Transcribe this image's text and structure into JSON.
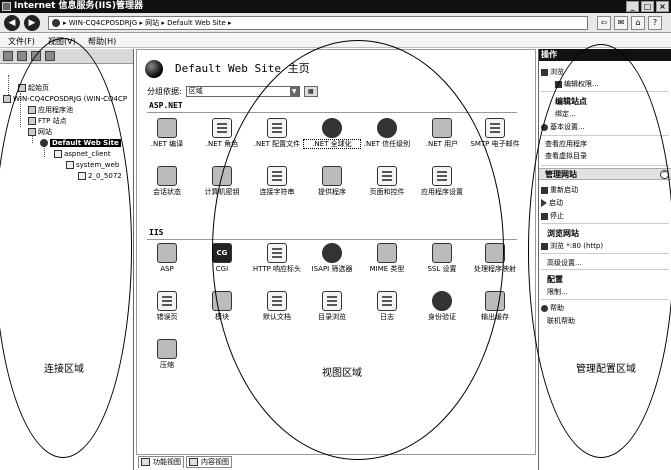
{
  "window": {
    "title": "Internet 信息服务(IIS)管理器",
    "controls": [
      "_",
      "□",
      "×"
    ]
  },
  "navbar": {
    "back": "◀",
    "forward": "▶",
    "address": "▸ WIN-CQ4CPOSDRJG ▸ 网站 ▸ Default Web Site ▸",
    "tools": [
      "⇦",
      "✉",
      "⌂",
      "?"
    ]
  },
  "menu": [
    "文件(F)",
    "视图(V)",
    "帮助(H)"
  ],
  "tree": [
    "起始页",
    "WIN-CQ4CPOSDRJG (WIN-CQ4CP",
    "应用程序池",
    "FTP 站点",
    "网站",
    "Default Web Site",
    "aspnet_client",
    "system_web",
    "2_0_5072"
  ],
  "center": {
    "title": "Default Web Site 主页",
    "group_by_label": "分组依据:",
    "group_by_value": "区域",
    "sections": {
      "aspnet": "ASP.NET",
      "iis": "IIS"
    },
    "aspnet_features": [
      ".NET 编译",
      ".NET 角色",
      ".NET 配置文件",
      ".NET 全球化",
      ".NET 信任级别",
      ".NET 用户",
      "SMTP 电子邮件",
      "会话状态",
      "计算机密钥",
      "连接字符串",
      "提供程序",
      "页面和控件",
      "应用程序设置"
    ],
    "iis_features": [
      "ASP",
      "CGI",
      "HTTP 响应标头",
      "ISAPI 筛选器",
      "MIME 类型",
      "SSL 设置",
      "处理程序映射",
      "错误页",
      "模块",
      "默认文档",
      "目录浏览",
      "日志",
      "身份验证",
      "输出缓存",
      "压缩"
    ],
    "cgi_glyph": "CG",
    "tabs": [
      "功能视图",
      "内容视图"
    ]
  },
  "actions": {
    "header": "操作",
    "items": [
      "浏览",
      "编辑权限...",
      "编辑站点",
      "绑定...",
      "基本设置...",
      "查看应用程序",
      "查看虚拟目录",
      "管理网站",
      "重新启动",
      "启动",
      "停止",
      "浏览网站",
      "浏览 *:80 (http)",
      "高级设置...",
      "配置",
      "限制...",
      "帮助",
      "联机帮助"
    ]
  },
  "annotations": {
    "left": "连接区域",
    "center": "视图区域",
    "right": "管理配置区域"
  }
}
